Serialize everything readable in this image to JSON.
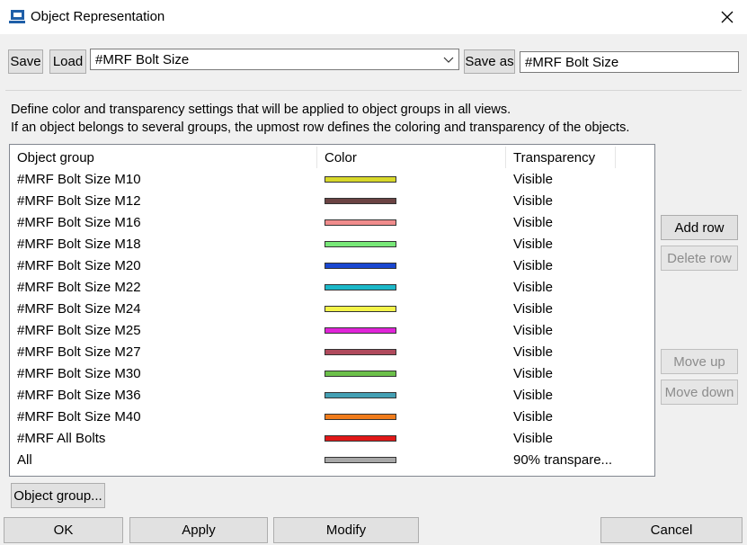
{
  "window": {
    "title": "Object Representation"
  },
  "toolbar": {
    "save_label": "Save",
    "load_label": "Load",
    "selected_setting": "#MRF Bolt Size",
    "save_as_label": "Save as",
    "save_as_value": "#MRF Bolt Size"
  },
  "description": {
    "line1": "Define color and transparency settings that will be applied to object groups in all views.",
    "line2": "If an object belongs to several groups, the upmost row defines the coloring and transparency of the objects."
  },
  "table": {
    "headers": {
      "group": "Object group",
      "color": "Color",
      "transparency": "Transparency"
    },
    "rows": [
      {
        "group": "#MRF Bolt Size M10",
        "color": "#d8d82a",
        "transparency": "Visible"
      },
      {
        "group": "#MRF Bolt Size M12",
        "color": "#6b4343",
        "transparency": "Visible"
      },
      {
        "group": "#MRF Bolt Size M16",
        "color": "#f08c8c",
        "transparency": "Visible"
      },
      {
        "group": "#MRF Bolt Size M18",
        "color": "#78e878",
        "transparency": "Visible"
      },
      {
        "group": "#MRF Bolt Size M20",
        "color": "#1a47d0",
        "transparency": "Visible"
      },
      {
        "group": "#MRF Bolt Size M22",
        "color": "#1cb8c8",
        "transparency": "Visible"
      },
      {
        "group": "#MRF Bolt Size M24",
        "color": "#f4f44a",
        "transparency": "Visible"
      },
      {
        "group": "#MRF Bolt Size M25",
        "color": "#e024d8",
        "transparency": "Visible"
      },
      {
        "group": "#MRF Bolt Size M27",
        "color": "#b04a5c",
        "transparency": "Visible"
      },
      {
        "group": "#MRF Bolt Size M30",
        "color": "#6cc04a",
        "transparency": "Visible"
      },
      {
        "group": "#MRF Bolt Size M36",
        "color": "#44a0b4",
        "transparency": "Visible"
      },
      {
        "group": "#MRF Bolt Size M40",
        "color": "#f07c1c",
        "transparency": "Visible"
      },
      {
        "group": "#MRF All Bolts",
        "color": "#e01818",
        "transparency": "Visible"
      },
      {
        "group": "All",
        "color": "#a8a8a8",
        "transparency": "90% transpare..."
      }
    ]
  },
  "side_buttons": {
    "add_row": "Add row",
    "delete_row": "Delete row",
    "move_up": "Move up",
    "move_down": "Move down"
  },
  "object_group_button": "Object group...",
  "footer": {
    "ok": "OK",
    "apply": "Apply",
    "modify": "Modify",
    "cancel": "Cancel"
  }
}
